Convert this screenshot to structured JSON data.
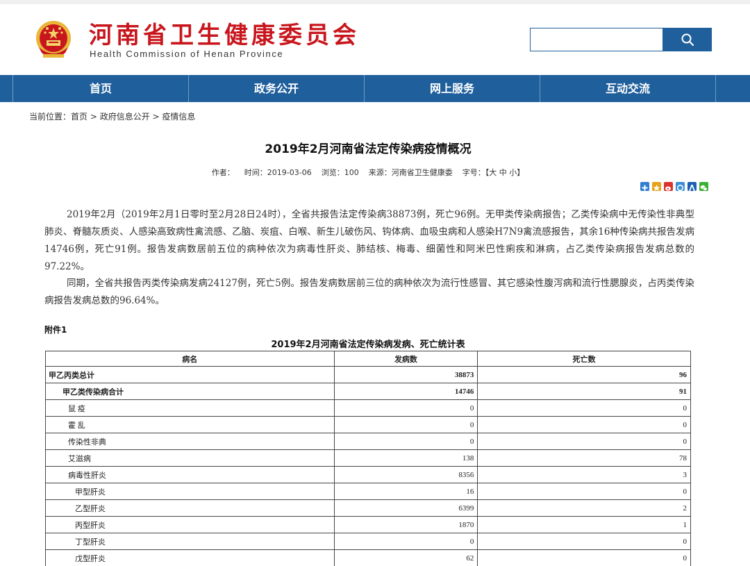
{
  "header": {
    "title": "河南省卫生健康委员会",
    "subtitle": "Health Commission of Henan Province",
    "emblem_icon": "national-emblem-icon"
  },
  "search": {
    "value": "",
    "placeholder": "",
    "button_icon": "search-icon"
  },
  "nav": {
    "items": [
      {
        "label": "首页"
      },
      {
        "label": "政务公开"
      },
      {
        "label": "网上服务"
      },
      {
        "label": "互动交流"
      }
    ]
  },
  "breadcrumb": {
    "prefix": "当前位置：",
    "items": [
      "首页",
      "政府信息公开",
      "疫情信息"
    ],
    "separator": " > "
  },
  "article": {
    "title": "2019年2月河南省法定传染病疫情概况",
    "meta": {
      "author": "作者：",
      "time": "时间：2019-03-06",
      "views": "浏览：100",
      "source": "来源：河南省卫生健康委",
      "size_label": "字号：",
      "size_open": "【",
      "size_large": "大",
      "size_medium": "中",
      "size_small": "小",
      "size_close": "】"
    },
    "paragraphs": [
      "2019年2月（2019年2月1日零时至2月28日24时），全省共报告法定传染病38873例，死亡96例。无甲类传染病报告；乙类传染病中无传染性非典型肺炎、脊髓灰质炎、人感染高致病性禽流感、乙脑、炭疽、白喉、新生儿破伤风、钩体病、血吸虫病和人感染H7N9禽流感报告，其余16种传染病共报告发病14746例，死亡91例。报告发病数居前五位的病种依次为病毒性肝炎、肺结核、梅毒、细菌性和阿米巴性痢疾和淋病，占乙类传染病报告发病总数的97.22%。",
      "同期，全省共报告丙类传染病发病24127例，死亡5例。报告发病数居前三位的病种依次为流行性感冒、其它感染性腹泻病和流行性腮腺炎，占丙类传染病报告发病总数的96.64%。"
    ]
  },
  "share_icons": [
    {
      "name": "share-plus-icon",
      "color": "#2f7fd0"
    },
    {
      "name": "share-qzone-icon",
      "color": "#e8a21a"
    },
    {
      "name": "share-weibo-icon",
      "color": "#d9352d"
    },
    {
      "name": "share-tqq-icon",
      "color": "#3a8fd6"
    },
    {
      "name": "share-renren-icon",
      "color": "#1a5fb4"
    },
    {
      "name": "share-wechat-icon",
      "color": "#3cb034"
    }
  ],
  "attachment": {
    "label": "附件1",
    "table_title": "2019年2月河南省法定传染病发病、死亡统计表",
    "headers": [
      "病名",
      "发病数",
      "死亡数"
    ],
    "rows": [
      {
        "name": "甲乙丙类总计",
        "cases": "38873",
        "deaths": "96",
        "level": 0,
        "bold": true
      },
      {
        "name": "甲乙类传染病合计",
        "cases": "14746",
        "deaths": "91",
        "level": 1,
        "bold": true
      },
      {
        "name": "鼠 疫",
        "cases": "0",
        "deaths": "0",
        "level": 2,
        "bold": false
      },
      {
        "name": "霍 乱",
        "cases": "0",
        "deaths": "0",
        "level": 2,
        "bold": false
      },
      {
        "name": "传染性非典",
        "cases": "0",
        "deaths": "0",
        "level": 2,
        "bold": false
      },
      {
        "name": "艾滋病",
        "cases": "138",
        "deaths": "78",
        "level": 2,
        "bold": false
      },
      {
        "name": "病毒性肝炎",
        "cases": "8356",
        "deaths": "3",
        "level": 2,
        "bold": false
      },
      {
        "name": "甲型肝炎",
        "cases": "16",
        "deaths": "0",
        "level": 3,
        "bold": false
      },
      {
        "name": "乙型肝炎",
        "cases": "6399",
        "deaths": "2",
        "level": 3,
        "bold": false
      },
      {
        "name": "丙型肝炎",
        "cases": "1870",
        "deaths": "1",
        "level": 3,
        "bold": false
      },
      {
        "name": "丁型肝炎",
        "cases": "0",
        "deaths": "0",
        "level": 3,
        "bold": false
      },
      {
        "name": "戊型肝炎",
        "cases": "62",
        "deaths": "0",
        "level": 3,
        "bold": false
      }
    ]
  },
  "colors": {
    "brand_red": "#c8161d",
    "nav_blue": "#1f5f9c"
  }
}
